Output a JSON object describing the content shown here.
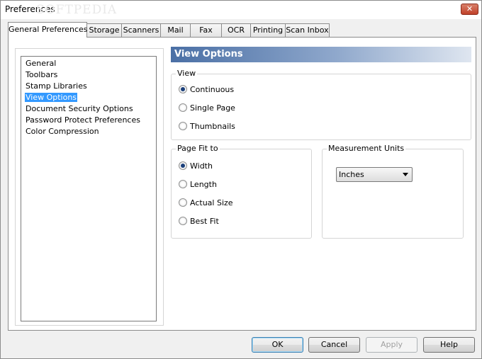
{
  "window": {
    "title": "Preferences",
    "watermark": "SOFTPEDIA",
    "close_glyph": "✕"
  },
  "tabs": [
    {
      "label": "General Preferences",
      "active": true
    },
    {
      "label": "Storage",
      "active": false
    },
    {
      "label": "Scanners",
      "active": false
    },
    {
      "label": "Mail",
      "active": false
    },
    {
      "label": "Fax",
      "active": false
    },
    {
      "label": "OCR",
      "active": false
    },
    {
      "label": "Printing",
      "active": false
    },
    {
      "label": "Scan Inbox",
      "active": false
    }
  ],
  "categories": [
    {
      "label": "General",
      "selected": false
    },
    {
      "label": "Toolbars",
      "selected": false
    },
    {
      "label": "Stamp Libraries",
      "selected": false
    },
    {
      "label": "View Options",
      "selected": true
    },
    {
      "label": "Document Security Options",
      "selected": false
    },
    {
      "label": "Password Protect Preferences",
      "selected": false
    },
    {
      "label": "Color Compression",
      "selected": false
    }
  ],
  "section_title": "View Options",
  "view_group": {
    "label": "View",
    "options": [
      {
        "label": "Continuous",
        "checked": true
      },
      {
        "label": "Single Page",
        "checked": false
      },
      {
        "label": "Thumbnails",
        "checked": false
      }
    ]
  },
  "page_fit_group": {
    "label": "Page Fit to",
    "options": [
      {
        "label": "Width",
        "checked": true
      },
      {
        "label": "Length",
        "checked": false
      },
      {
        "label": "Actual Size",
        "checked": false
      },
      {
        "label": "Best Fit",
        "checked": false
      }
    ]
  },
  "units_group": {
    "label": "Measurement Units",
    "selected": "Inches"
  },
  "buttons": {
    "ok": "OK",
    "cancel": "Cancel",
    "apply": "Apply",
    "help": "Help"
  },
  "colors": {
    "selection": "#3399ff",
    "header_start": "#4a6fa5",
    "close_button": "#c0412a"
  }
}
